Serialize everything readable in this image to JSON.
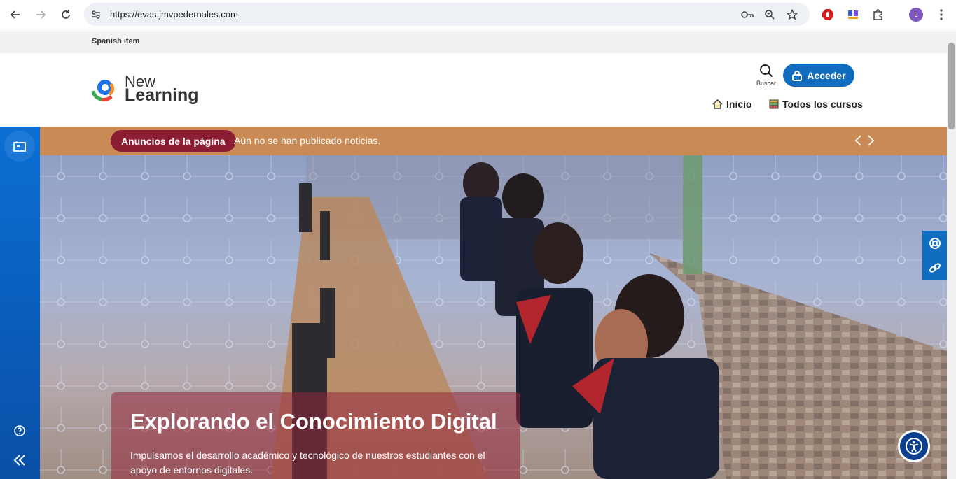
{
  "browser": {
    "url": "https://evas.jmvpedernales.com",
    "profile_initial": "L"
  },
  "topbar": {
    "language": "Spanish item"
  },
  "header": {
    "logo_line1": "New",
    "logo_line2": "Learning",
    "search_label": "Buscar",
    "login_label": "Acceder",
    "nav": [
      {
        "label": "Inicio",
        "icon": "home-icon"
      },
      {
        "label": "Todos los cursos",
        "icon": "courses-icon"
      }
    ]
  },
  "announcements": {
    "badge": "Anuncios de la página",
    "message": "Aún no se han publicado noticias."
  },
  "hero": {
    "title": "Explorando el Conocimiento Digital",
    "description": "Impulsamos el desarrollo académico y tecnológico de nuestros estudiantes con el apoyo de entornos digitales."
  },
  "colors": {
    "brand_blue": "#0f6cbf",
    "announcement_bar": "#c98a55",
    "announcement_badge": "#8b1e33",
    "rail_blue": "#0b6fd4"
  }
}
